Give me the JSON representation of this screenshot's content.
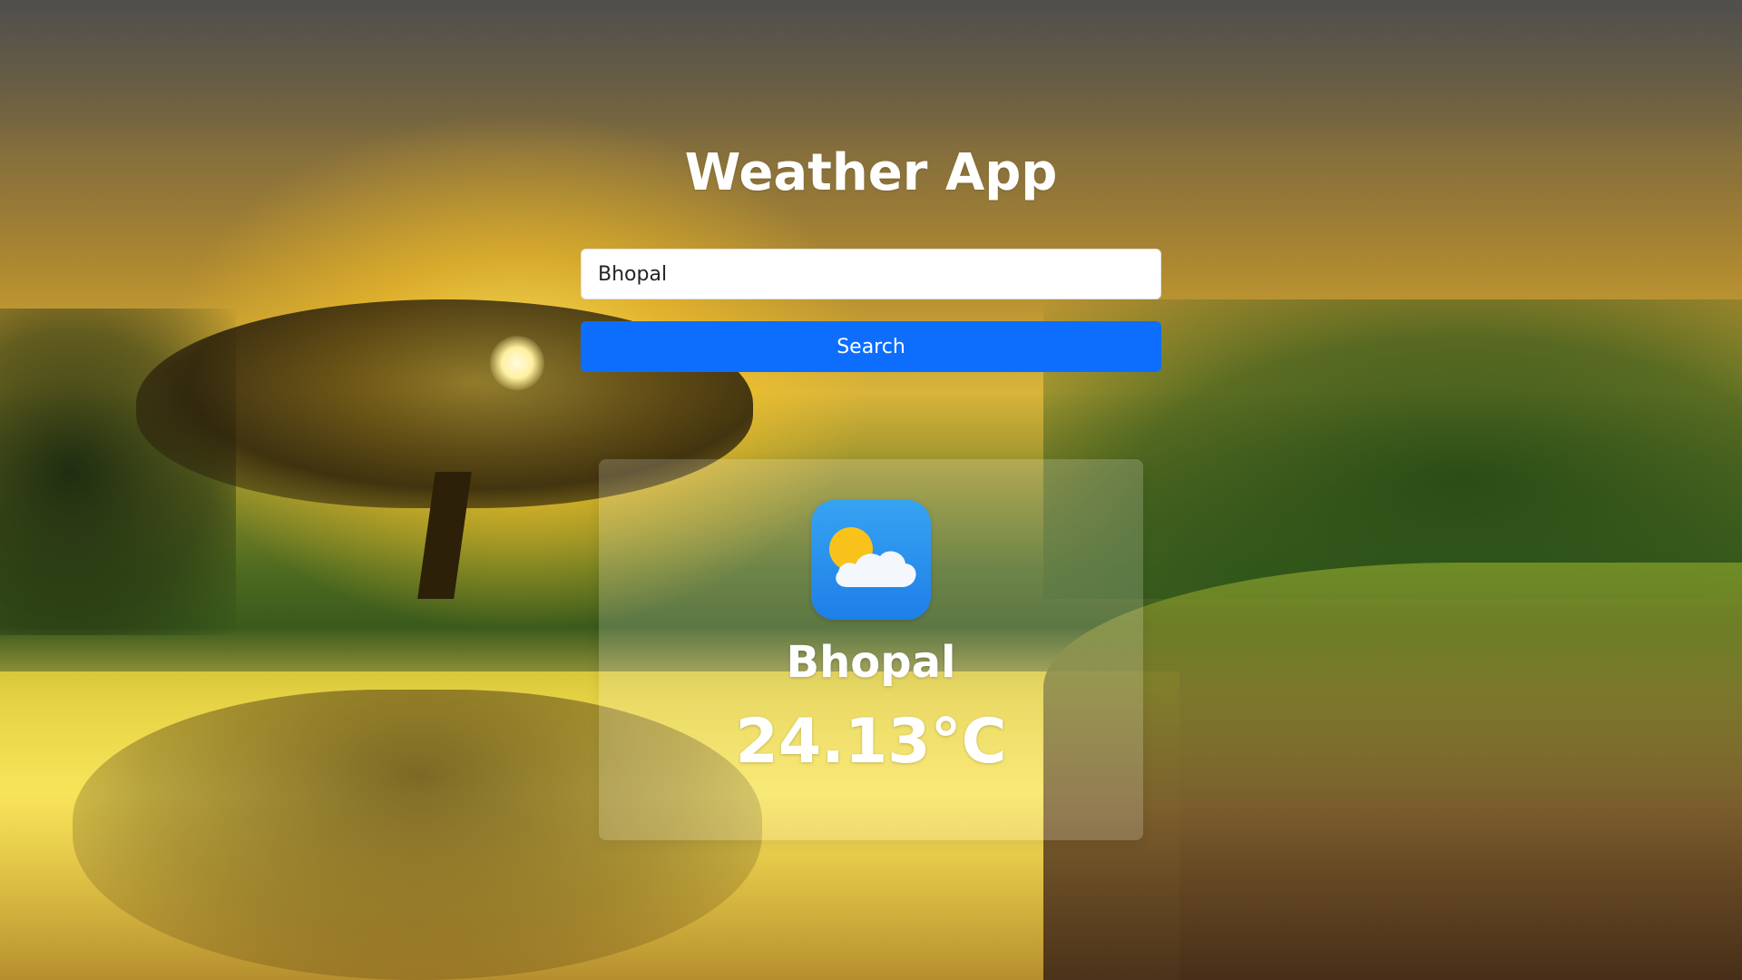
{
  "app": {
    "title": "Weather App"
  },
  "search": {
    "value": "Bhopal",
    "button_label": "Search"
  },
  "weather": {
    "icon": "sun-behind-cloud-icon",
    "city": "Bhopal",
    "temperature": "24.13°C"
  },
  "colors": {
    "button_bg": "#0d6efd",
    "button_text": "#ffffff",
    "title_text": "#ffffff",
    "icon_bg": "#2b90ee",
    "sun": "#f9c21b",
    "cloud": "#f4f8fd"
  }
}
